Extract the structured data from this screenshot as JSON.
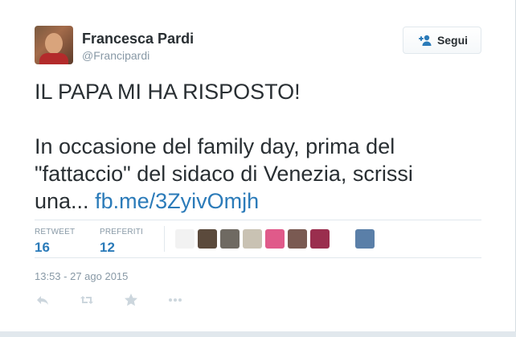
{
  "user": {
    "name": "Francesca Pardi",
    "handle": "@Francipardi"
  },
  "follow_button": {
    "label": "Segui",
    "icon": "follow-person-icon"
  },
  "tweet": {
    "text_line1": "IL PAPA MI HA RISPOSTO!",
    "text_body": "In occasione del family day, prima del\n\"fattaccio\" del sidaco di Venezia, scrissi\nuna... ",
    "link": "fb.me/3ZyivOmjh"
  },
  "stats": {
    "retweets": {
      "label": "RETWEET",
      "value": "16"
    },
    "favorites": {
      "label": "PREFERITI",
      "value": "12"
    }
  },
  "favoriter_avatars": [
    {
      "color": "#f2f2f2",
      "name": "avatar-1"
    },
    {
      "color": "#5b4a3c",
      "name": "avatar-2"
    },
    {
      "color": "#6f6a62",
      "name": "avatar-3"
    },
    {
      "color": "#c9c2b3",
      "name": "avatar-4"
    },
    {
      "color": "#e05a8a",
      "name": "avatar-5"
    },
    {
      "color": "#7a5a52",
      "name": "avatar-6"
    },
    {
      "color": "#9a2e4e",
      "name": "avatar-7"
    },
    {
      "color": "#ffffff",
      "name": "avatar-8"
    },
    {
      "color": "#5a7fa8",
      "name": "avatar-9"
    }
  ],
  "timestamp": "13:53 - 27 ago 2015",
  "actions": [
    "reply-icon",
    "retweet-icon",
    "favorite-star-icon",
    "more-dots-icon"
  ],
  "colors": {
    "link": "#2b7bb9",
    "muted": "#8899a6",
    "text": "#292f33"
  }
}
